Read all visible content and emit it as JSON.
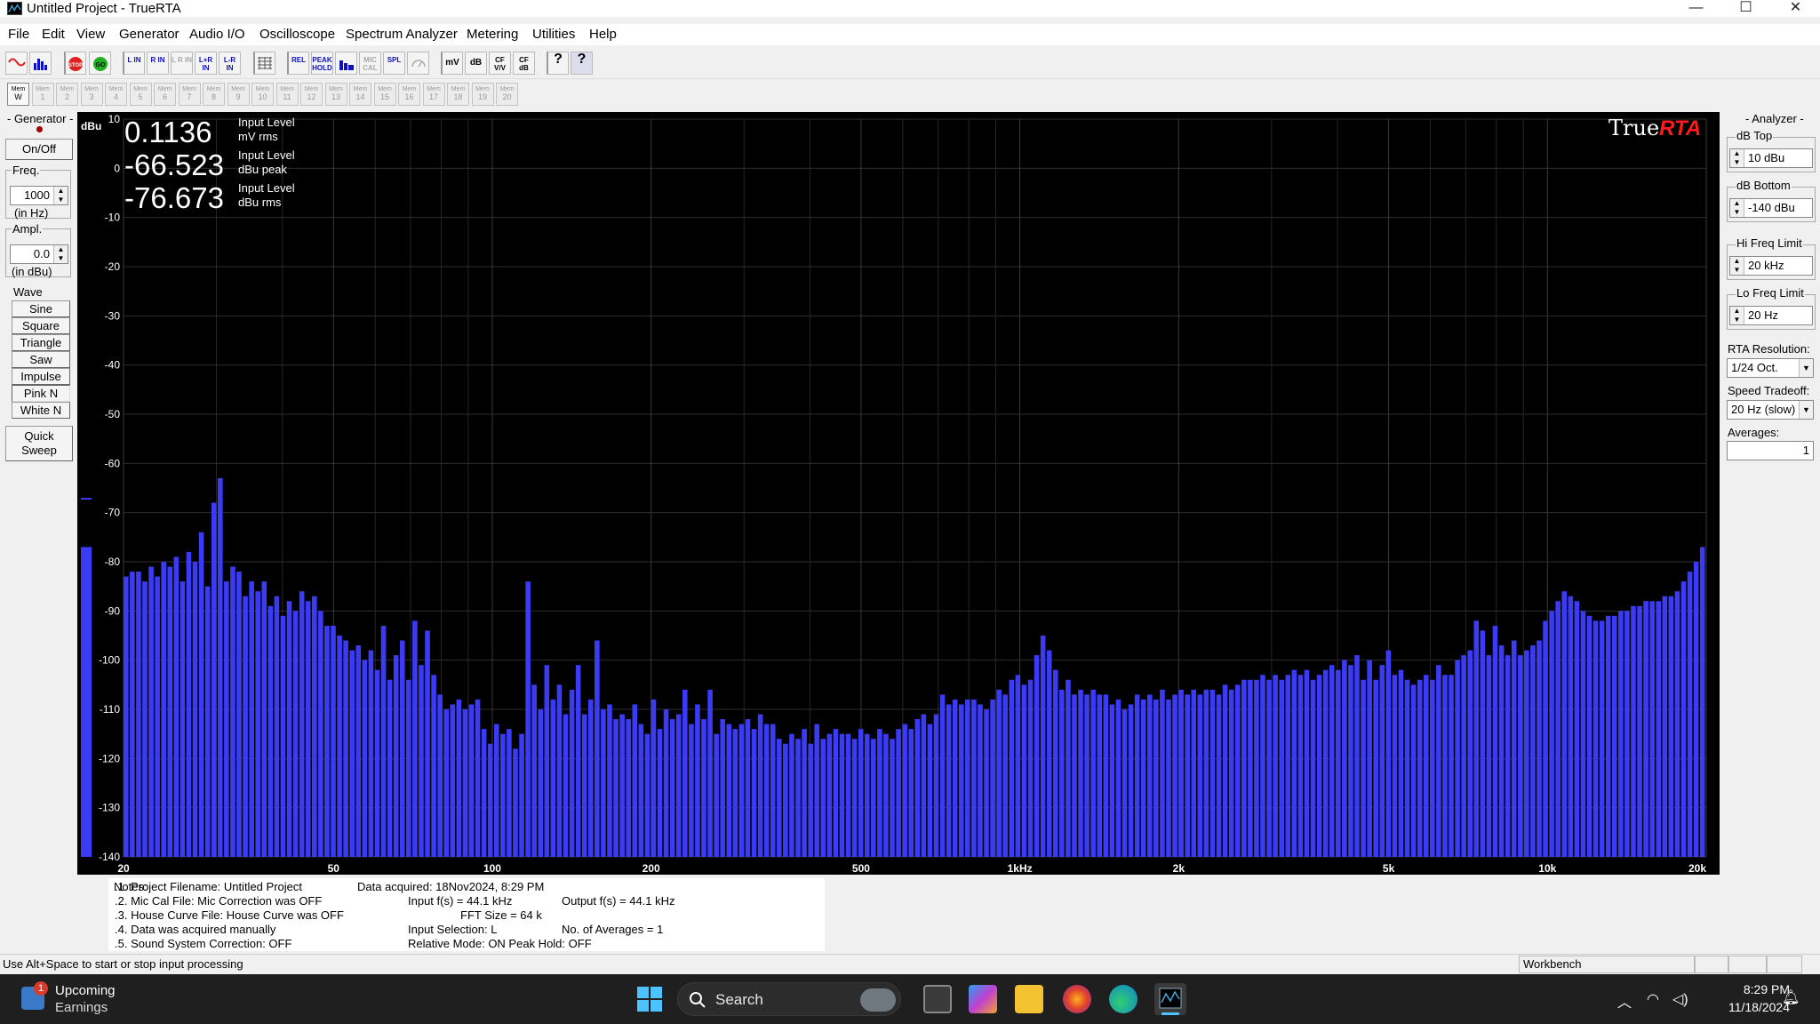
{
  "window": {
    "title": "Untitled Project - TrueRTA",
    "controls": [
      "—",
      "☐",
      "✕"
    ]
  },
  "menu": [
    "File",
    "Edit",
    "View",
    "Generator",
    "Audio I/O",
    "Oscilloscope",
    "Spectrum Analyzer",
    "Metering",
    "Utilities",
    "Help"
  ],
  "toolbar": {
    "buttons": [
      {
        "name": "generator-sine-icon",
        "label": ""
      },
      {
        "name": "rta-view-icon",
        "label": ""
      },
      {
        "name": "stop-button",
        "label": "STOP"
      },
      {
        "name": "go-button",
        "label": "GO"
      },
      {
        "name": "left-in-button",
        "label": "L IN"
      },
      {
        "name": "right-in-button",
        "label": "R IN"
      },
      {
        "name": "left-right-in-button",
        "label": "L R IN"
      },
      {
        "name": "l-plus-r-in-button",
        "label": "L+R IN"
      },
      {
        "name": "l-minus-r-in-button",
        "label": "L-R IN"
      },
      {
        "name": "grid-icon",
        "label": ""
      },
      {
        "name": "rel-button",
        "label": "REL"
      },
      {
        "name": "peak-hold-button",
        "label": "PEAK HOLD"
      },
      {
        "name": "bars-button",
        "label": ""
      },
      {
        "name": "mic-cal-button",
        "label": "MIC CAL"
      },
      {
        "name": "spl-button",
        "label": "SPL"
      },
      {
        "name": "meter-icon",
        "label": ""
      },
      {
        "name": "mv-button",
        "label": "mV"
      },
      {
        "name": "db-button",
        "label": "dB"
      },
      {
        "name": "cf-vv-button",
        "label": "CF V/V"
      },
      {
        "name": "cf-db-button",
        "label": "CF dB"
      },
      {
        "name": "help-button",
        "label": "?"
      },
      {
        "name": "context-help-button",
        "label": "?"
      }
    ],
    "memory_label": "Mem",
    "memory_slots": [
      "W",
      "1",
      "2",
      "3",
      "4",
      "5",
      "6",
      "7",
      "8",
      "9",
      "10",
      "11",
      "12",
      "13",
      "14",
      "15",
      "16",
      "17",
      "18",
      "19",
      "20"
    ]
  },
  "generator": {
    "title": "- Generator -",
    "onoff": "On/Off",
    "freq_label": "Freq.",
    "freq_value": "1000",
    "freq_unit": "(in Hz)",
    "ampl_label": "Ampl.",
    "ampl_value": "0.0",
    "ampl_unit": "(in dBu)",
    "wave_label": "Wave",
    "waves": [
      "Sine",
      "Square",
      "Triangle",
      "Saw",
      "Impulse",
      "Pink N",
      "White N"
    ],
    "quick_sweep": [
      "Quick",
      "Sweep"
    ]
  },
  "readouts": [
    {
      "value": "0.1136",
      "label1": "Input Level",
      "label2": "mV rms"
    },
    {
      "value": "-66.523",
      "label1": "Input Level",
      "label2": "dBu peak"
    },
    {
      "value": "-76.673",
      "label1": "Input Level",
      "label2": "dBu rms"
    }
  ],
  "logo": {
    "a": "True",
    "b": "RTA"
  },
  "analyzer": {
    "title": "- Analyzer -",
    "db_top_label": "dB Top",
    "db_top": "10 dBu",
    "db_bottom_label": "dB Bottom",
    "db_bottom": "-140 dBu",
    "hi_freq_label": "Hi Freq Limit",
    "hi_freq": "20 kHz",
    "lo_freq_label": "Lo Freq Limit",
    "lo_freq": "20 Hz",
    "resolution_label": "RTA Resolution:",
    "resolution": "1/24 Oct.",
    "speed_label": "Speed Tradeoff:",
    "speed": "20 Hz (slow)",
    "averages_label": "Averages:",
    "averages": "1"
  },
  "chart_data": {
    "type": "bar",
    "ylabel": "dBu",
    "ylim": [
      -140,
      10
    ],
    "yticks": [
      "10",
      "0",
      "-10",
      "-20",
      "-30",
      "-40",
      "-50",
      "-60",
      "-70",
      "-80",
      "-90",
      "-100",
      "-110",
      "-120",
      "-130",
      "-140"
    ],
    "xscale": "log",
    "xlim_hz": [
      20,
      20000
    ],
    "xticks": [
      {
        "hz": 20,
        "label": "20"
      },
      {
        "hz": 50,
        "label": "50"
      },
      {
        "hz": 100,
        "label": "100"
      },
      {
        "hz": 200,
        "label": "200"
      },
      {
        "hz": 500,
        "label": "500"
      },
      {
        "hz": 1000,
        "label": "1kHz"
      },
      {
        "hz": 2000,
        "label": "2k"
      },
      {
        "hz": 5000,
        "label": "5k"
      },
      {
        "hz": 10000,
        "label": "10k"
      },
      {
        "hz": 20000,
        "label": "20k"
      }
    ],
    "bar_color": "#3b3bf5",
    "background": "#000000",
    "grid": true,
    "overall_level_bar_dbu": -77,
    "values_dbu": [
      -83,
      -82,
      -82,
      -84,
      -81,
      -83,
      -80,
      -81,
      -79,
      -84,
      -78,
      -80,
      -74,
      -85,
      -68,
      -63,
      -84,
      -81,
      -82,
      -87,
      -84,
      -86,
      -84,
      -89,
      -87,
      -91,
      -88,
      -90,
      -86,
      -88,
      -87,
      -90,
      -93,
      -93,
      -95,
      -96,
      -98,
      -97,
      -100,
      -98,
      -102,
      -93,
      -104,
      -99,
      -96,
      -104,
      -92,
      -101,
      -94,
      -103,
      -107,
      -110,
      -109,
      -108,
      -110,
      -109,
      -108,
      -114,
      -117,
      -113,
      -115,
      -114,
      -118,
      -115,
      -84,
      -105,
      -110,
      -101,
      -108,
      -105,
      -111,
      -106,
      -101,
      -111,
      -108,
      -96,
      -110,
      -109,
      -112,
      -111,
      -112,
      -109,
      -113,
      -115,
      -108,
      -114,
      -110,
      -112,
      -111,
      -106,
      -113,
      -109,
      -112,
      -106,
      -115,
      -112,
      -113,
      -114,
      -113,
      -112,
      -114,
      -111,
      -113,
      -113,
      -116,
      -117,
      -115,
      -116,
      -114,
      -117,
      -113,
      -116,
      -115,
      -114,
      -115,
      -115,
      -116,
      -114,
      -115,
      -116,
      -114,
      -115,
      -116,
      -114,
      -113,
      -114,
      -112,
      -111,
      -113,
      -111,
      -107,
      -109,
      -108,
      -109,
      -108,
      -108,
      -109,
      -110,
      -108,
      -106,
      -107,
      -104,
      -103,
      -105,
      -104,
      -99,
      -95,
      -98,
      -102,
      -106,
      -104,
      -107,
      -106,
      -107,
      -106,
      -107,
      -107,
      -109,
      -108,
      -110,
      -109,
      -107,
      -108,
      -107,
      -108,
      -106,
      -108,
      -107,
      -106,
      -107,
      -106,
      -107,
      -106,
      -106,
      -107,
      -105,
      -106,
      -105,
      -104,
      -104,
      -104,
      -103,
      -104,
      -103,
      -104,
      -103,
      -102,
      -103,
      -102,
      -104,
      -103,
      -102,
      -101,
      -102,
      -100,
      -101,
      -99,
      -104,
      -100,
      -104,
      -101,
      -98,
      -103,
      -102,
      -104,
      -105,
      -104,
      -103,
      -104,
      -101,
      -103,
      -103,
      -100,
      -99,
      -98,
      -92,
      -94,
      -99,
      -93,
      -97,
      -99,
      -96,
      -99,
      -98,
      -97,
      -96,
      -92,
      -90,
      -88,
      -86,
      -87,
      -88,
      -90,
      -91,
      -92,
      -92,
      -91,
      -91,
      -90,
      -90,
      -89,
      -89,
      -88,
      -88,
      -88,
      -87,
      -87,
      -86,
      -84,
      -82,
      -80,
      -77
    ]
  },
  "notes": {
    "label": "Notes:",
    "lines": [
      ".1. Project Filename: Untitled Project",
      ".2. Mic Cal File: Mic Correction was OFF",
      ".3. House Curve File: House Curve was OFF",
      ".4. Data was acquired manually",
      ".5. Sound System Correction: OFF"
    ],
    "acquired": "Data acquired: 18Nov2024, 8:29 PM",
    "input_fs": "Input f(s) = 44.1 kHz",
    "output_fs": "Output f(s) = 44.1 kHz",
    "fft_size": "FFT Size = 64 k",
    "input_selection": "Input Selection: L",
    "averages": "No. of Averages = 1",
    "relative_mode": "Relative Mode: ON  Peak Hold: OFF"
  },
  "status": {
    "message": "Use Alt+Space to start or stop input processing",
    "pane": "Workbench"
  },
  "taskbar": {
    "weather_title": "Upcoming",
    "weather_sub": "Earnings",
    "badge": "1",
    "search": "Search",
    "time": "8:29 PM",
    "date": "11/18/2024"
  }
}
